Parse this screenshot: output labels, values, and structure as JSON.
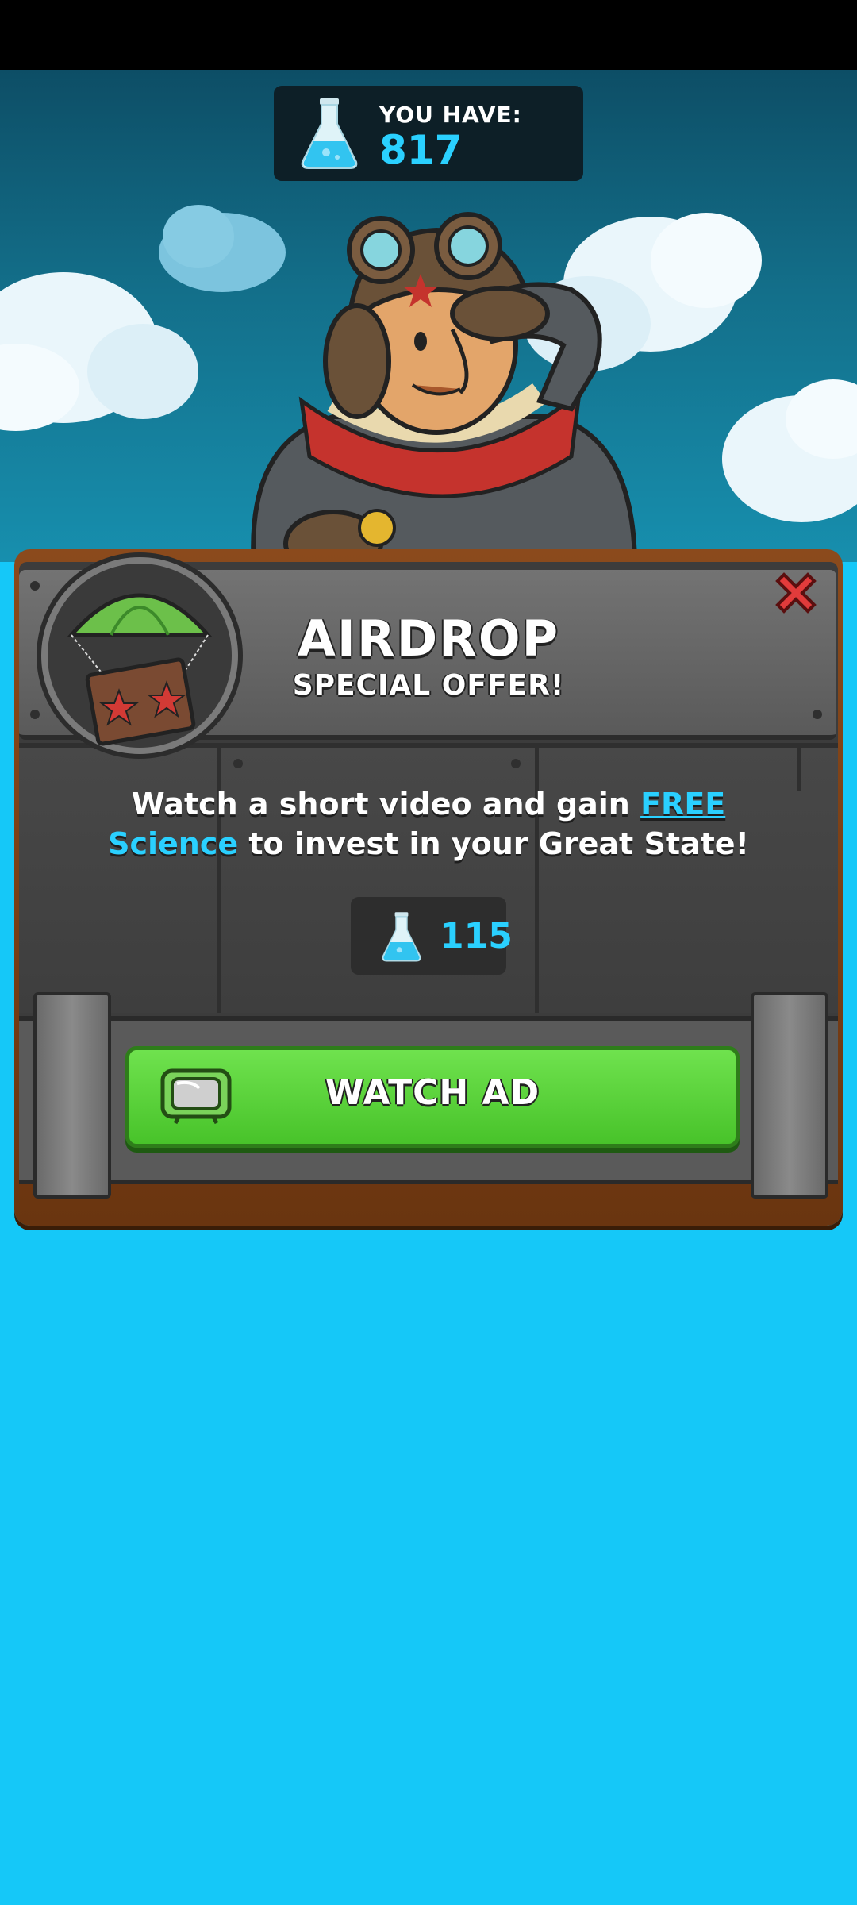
{
  "currency": {
    "label": "YOU HAVE:",
    "value": "817",
    "icon": "flask-icon"
  },
  "offer": {
    "title": "AIRDROP",
    "subtitle": "SPECIAL OFFER!",
    "description_pre": "Watch a short video and gain ",
    "description_free": "FREE",
    "description_space": " ",
    "description_science": "Science",
    "description_post": " to invest in your Great State!",
    "reward_value": "115"
  },
  "watch_button": {
    "label": "WATCH AD"
  },
  "colors": {
    "accent": "#2ad0ff",
    "button_green": "#5fd83e",
    "close_red": "#e23b3b",
    "background": "#15c8f8"
  }
}
